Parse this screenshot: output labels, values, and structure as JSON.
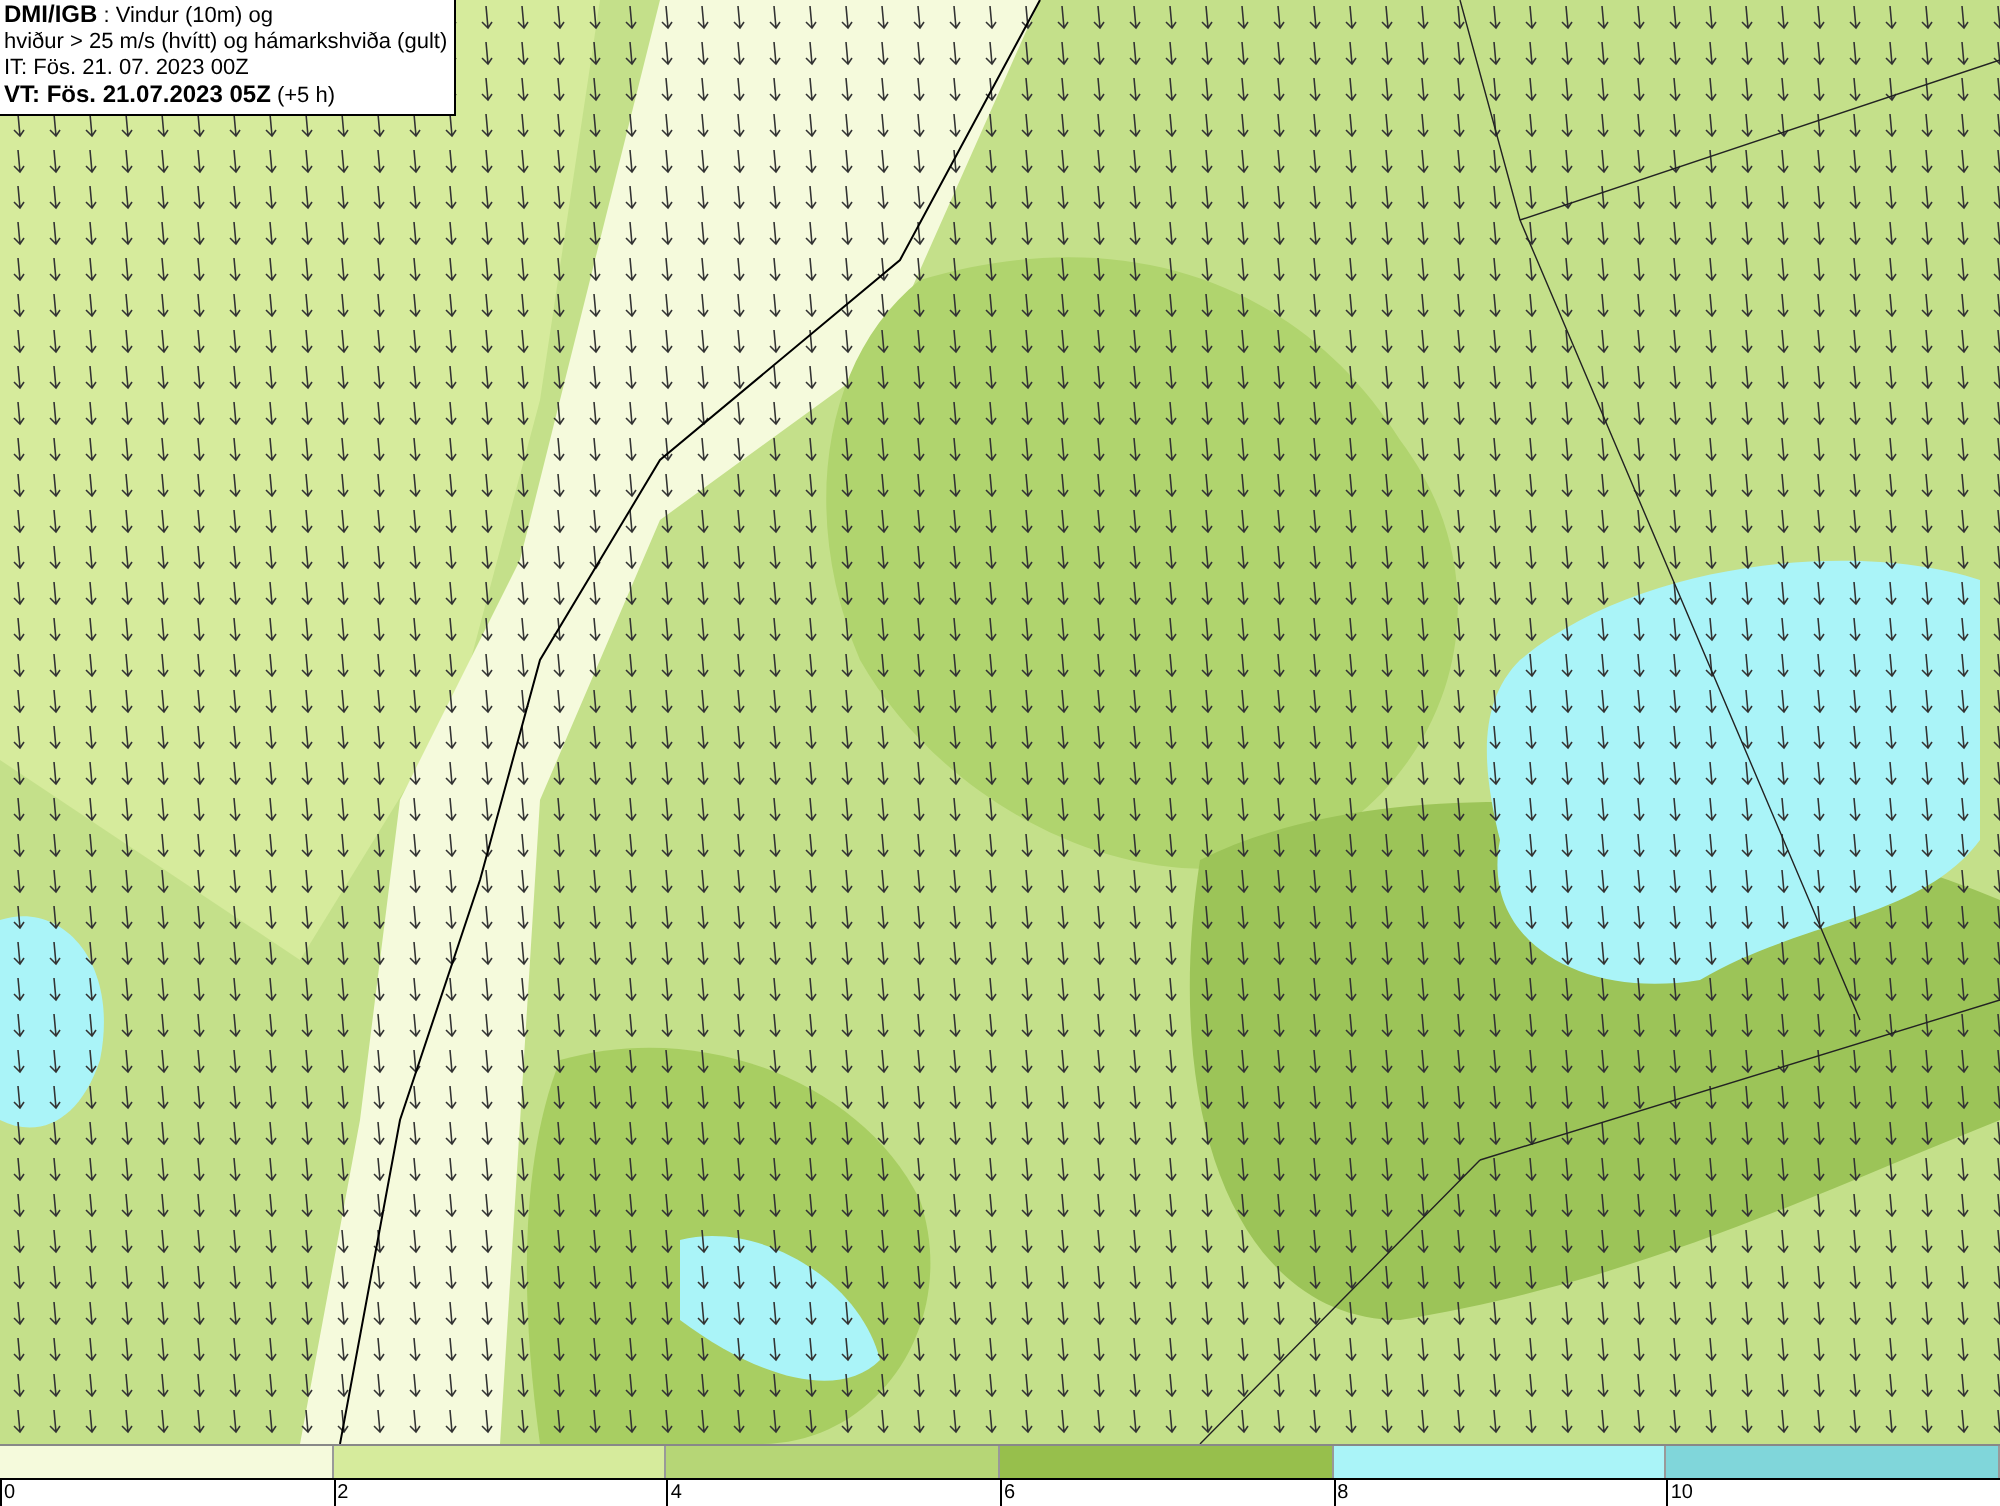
{
  "title_box": {
    "lines": [
      "**DMI/IGB** : Vindur (10m) og",
      "hviður > 25 m/s (hvítt) og hámarkshviða (gult)",
      "IT: Fös. 21. 07. 2023 00Z",
      "**VT: Fös. 21.07.2023 05Z** (+5 h)"
    ]
  },
  "legend": {
    "segments": [
      {
        "label": "0",
        "color": "#f5fadc"
      },
      {
        "label": "2",
        "color": "#d6eb9c"
      },
      {
        "label": "4",
        "color": "#b6d676"
      },
      {
        "label": "6",
        "color": "#97bf4c"
      },
      {
        "label": "8",
        "color": "#aaf4f8"
      },
      {
        "label": "10",
        "color": "#80d6da"
      }
    ]
  }
}
